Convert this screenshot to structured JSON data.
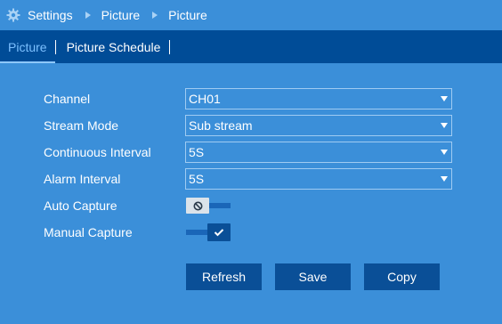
{
  "breadcrumb": {
    "items": [
      "Settings",
      "Picture",
      "Picture"
    ]
  },
  "tabs": [
    {
      "label": "Picture",
      "active": true
    },
    {
      "label": "Picture Schedule",
      "active": false
    }
  ],
  "form": {
    "channel": {
      "label": "Channel",
      "value": "CH01"
    },
    "stream_mode": {
      "label": "Stream Mode",
      "value": "Sub stream"
    },
    "continuous_interval": {
      "label": "Continuous Interval",
      "value": "5S"
    },
    "alarm_interval": {
      "label": "Alarm Interval",
      "value": "5S"
    },
    "auto_capture": {
      "label": "Auto Capture",
      "enabled": false
    },
    "manual_capture": {
      "label": "Manual Capture",
      "enabled": true
    }
  },
  "buttons": {
    "refresh": "Refresh",
    "save": "Save",
    "copy": "Copy"
  },
  "colors": {
    "background": "#3b8fd9",
    "tabbar": "#004c97",
    "button": "#0a4f97",
    "active_tab": "#7cc0ff"
  },
  "icons": {
    "header": "gear-icon",
    "breadcrumb_separator": "chevron-right-icon",
    "select_arrow": "caret-down-icon"
  }
}
